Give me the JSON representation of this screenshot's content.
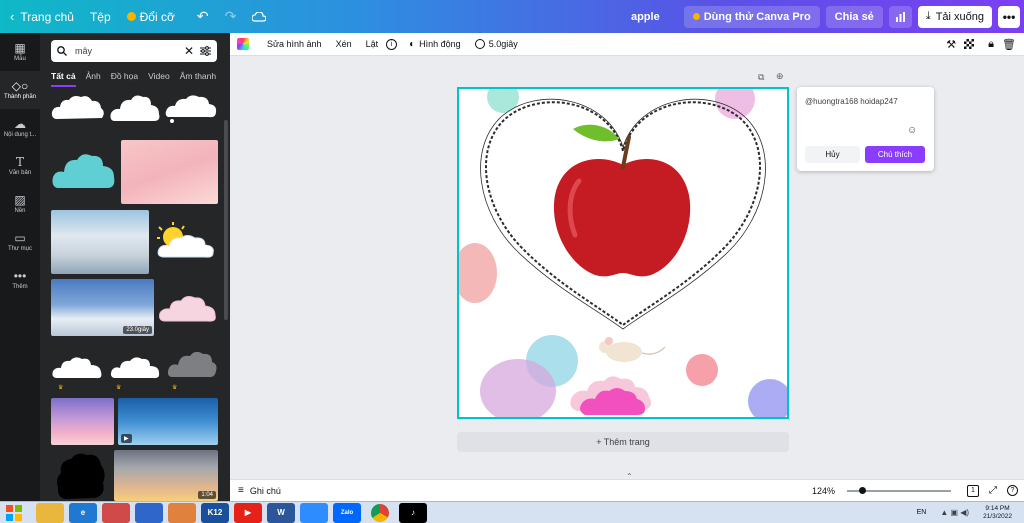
{
  "topbar": {
    "home_label": "Trang chủ",
    "file_label": "Tệp",
    "resize_label": "Đổi cỡ",
    "design_title": "apple",
    "trial_label": "Dùng thử Canva Pro",
    "share_label": "Chia sẻ",
    "download_label": "Tải xuống"
  },
  "rail": {
    "items": [
      {
        "label": "Mẫu",
        "icon": "template-icon"
      },
      {
        "label": "Thành phần",
        "icon": "elements-icon"
      },
      {
        "label": "Nội dung t...",
        "icon": "upload-icon"
      },
      {
        "label": "Văn bản",
        "icon": "text-icon"
      },
      {
        "label": "Nền",
        "icon": "background-icon"
      },
      {
        "label": "Thư mục",
        "icon": "folder-icon"
      },
      {
        "label": "Thêm",
        "icon": "more-icon"
      }
    ]
  },
  "panel": {
    "search_value": "mây",
    "tabs": [
      "Tất cả",
      "Ảnh",
      "Đồ họa",
      "Video",
      "Âm thanh"
    ],
    "video_duration": "23.0giây",
    "video_duration_2": "1:04"
  },
  "context_toolbar": {
    "edit_image": "Sửa hình ảnh",
    "crop": "Xén",
    "flip": "Lật",
    "animate": "Hình động",
    "duration": "5.0giây"
  },
  "comment": {
    "text": "@huongtra168 hoidap247",
    "cancel": "Hủy",
    "submit": "Chú thích"
  },
  "canvas": {
    "add_page": "+ Thêm trang"
  },
  "bottombar": {
    "notes": "Ghi chú",
    "zoom": "124%",
    "page_count": "1",
    "zoom_fraction": 0.12
  },
  "taskbar": {
    "lang": "EN",
    "time": "9:14 PM",
    "date": "21/3/2022"
  },
  "colors": {
    "accent": "#8b3dff",
    "selection": "#00c4cc"
  }
}
